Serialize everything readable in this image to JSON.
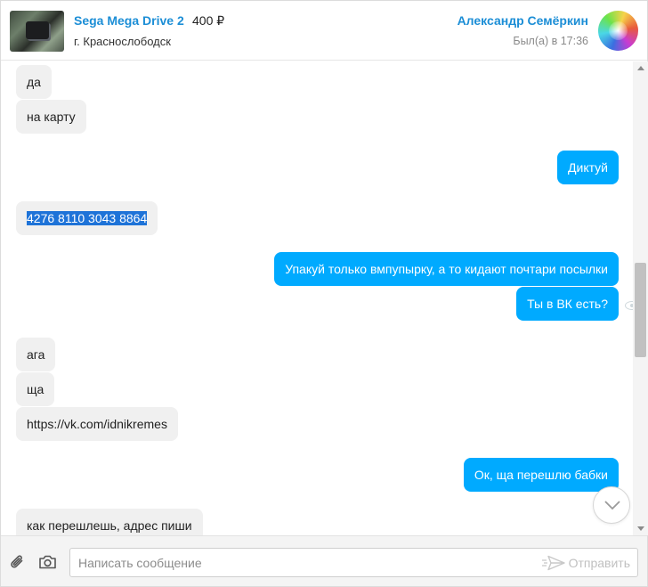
{
  "header": {
    "ad_title": "Sega Mega Drive 2",
    "ad_price": "400 ₽",
    "ad_city": "г. Краснослободск",
    "user_name": "Александр Семёркин",
    "user_status": "Был(а) в 17:36"
  },
  "messages": [
    {
      "dir": "in",
      "text": "да"
    },
    {
      "dir": "in",
      "text": "на карту"
    },
    {
      "dir": "out",
      "text": "Диктуй"
    },
    {
      "dir": "in",
      "text": "4276 8110 3043 8864",
      "selected": true
    },
    {
      "dir": "out",
      "text": "Упакуй только вмпупырку, а то кидают почтари посылки"
    },
    {
      "dir": "out",
      "text": "Ты в ВК есть?"
    },
    {
      "dir": "in",
      "text": "ага"
    },
    {
      "dir": "in",
      "text": "ща"
    },
    {
      "dir": "in",
      "text": "https://vk.com/idnikremes"
    },
    {
      "dir": "out",
      "text": "Ок, ща перешлю бабки"
    },
    {
      "dir": "in",
      "text": "как перешлешь, адрес пиши"
    }
  ],
  "composer": {
    "placeholder": "Написать сообщение",
    "send_label": "Отправить"
  },
  "icons": {
    "attach": "paperclip-icon",
    "camera": "camera-icon",
    "send": "paper-plane-icon",
    "scroll_down": "chevron-down-icon",
    "read": "eye-icon"
  },
  "colors": {
    "accent": "#1c8ed6",
    "outgoing_bubble": "#00aaff",
    "incoming_bubble": "#f0f0f0",
    "selection": "#1e73d8"
  }
}
